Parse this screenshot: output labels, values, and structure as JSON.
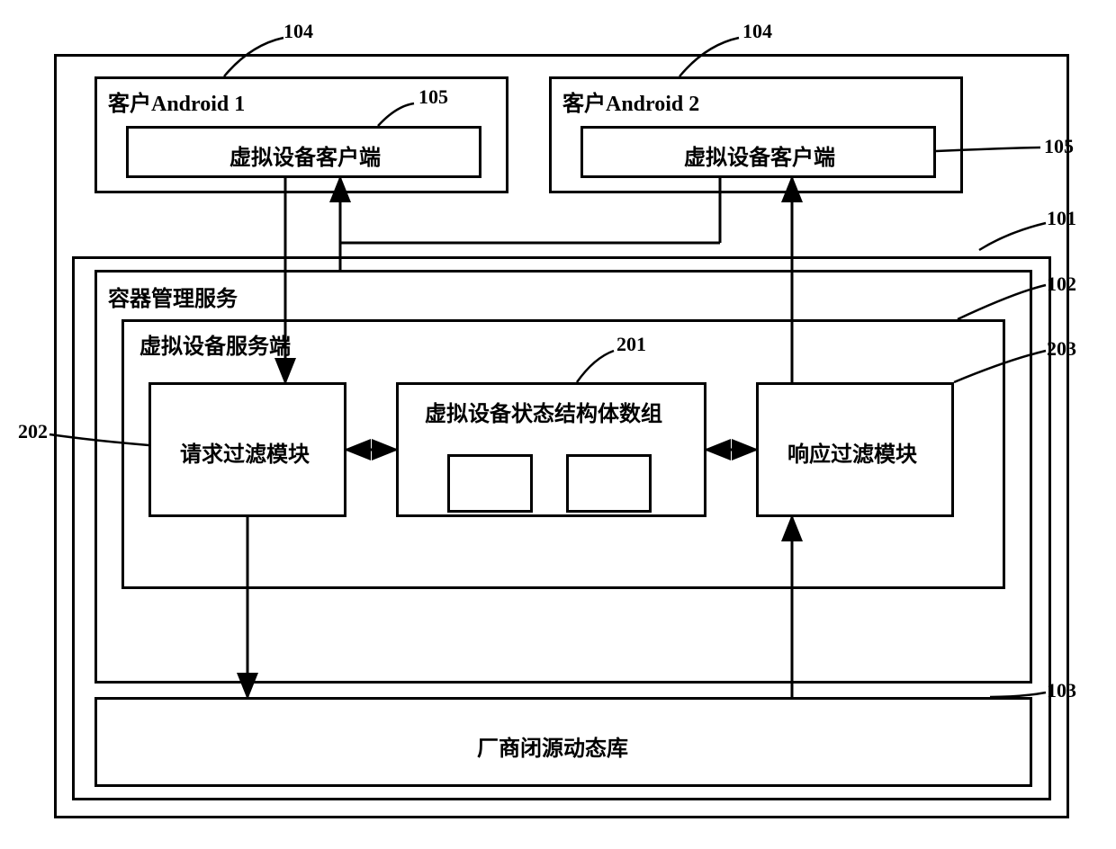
{
  "refs": {
    "r104a": "104",
    "r104b": "104",
    "r105a": "105",
    "r105b": "105",
    "r101": "101",
    "r102": "102",
    "r201": "201",
    "r202": "202",
    "r203": "203",
    "r103": "103"
  },
  "labels": {
    "client1Title": "客户Android 1",
    "client2Title": "客户Android 2",
    "virtualDeviceClient1": "虚拟设备客户端",
    "virtualDeviceClient2": "虚拟设备客户端",
    "containerService": "容器管理服务",
    "virtualDeviceServer": "虚拟设备服务端",
    "requestFilter": "请求过滤模块",
    "stateArray": "虚拟设备状态结构体数组",
    "responseFilter": "响应过滤模块",
    "vendorLib": "厂商闭源动态库"
  }
}
